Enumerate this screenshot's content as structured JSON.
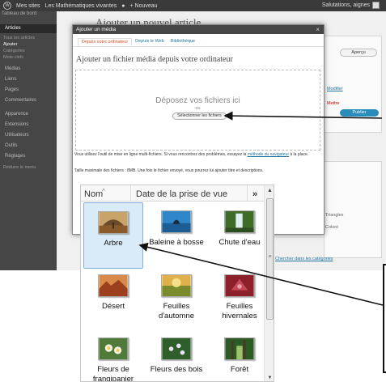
{
  "admin_bar": {
    "my_sites": "Mes sites",
    "site_name": "Les Mathématiques vivantes",
    "new_label": "+ Nouveau",
    "greeting": "Salutations, aignes"
  },
  "admin_menu": {
    "site_title": "Tableau de bord",
    "items": [
      "Articles",
      "Tous les articles",
      "Ajouter",
      "Catégories",
      "Mots-clefs",
      "Médias",
      "Liens",
      "Pages",
      "Commentaires",
      "Apparence",
      "Extensions",
      "Utilisateurs",
      "Outils",
      "Réglages",
      "Réduire le menu"
    ]
  },
  "editor": {
    "page_title": "Ajouter un nouvel article",
    "publish_button": "Publier",
    "save_button": "Aperçu",
    "side_link": "Modifier",
    "side_red": "Mettre",
    "side_links": [
      "Triangles",
      "Coloré"
    ],
    "bottom_link": "Chercher dans les catégories"
  },
  "modal": {
    "title": "Ajouter un média",
    "close": "×",
    "tabs": [
      "Depuis votre ordinateur",
      "Depuis le Web",
      "Bibliothèque"
    ],
    "upload_title": "Ajouter un fichier média depuis votre ordinateur",
    "drop_text": "Déposez vos fichiers ici",
    "or_text": "ou",
    "select_button": "Sélectionner les fichiers",
    "note_start": "Vous utilisez l'outil de mise en ligne multi-fichiers. Si vous rencontrez des problèmes, essayez la ",
    "note_link": "méthode du navigateur",
    "note_end": " à la place.",
    "max_size": "Taille maximale des fichiers : 8MB. Une fois le fichier envoyé, vous pourrez lui ajouter titre et descriptions."
  },
  "explorer": {
    "columns": [
      "Nom",
      "Date de la prise de vue",
      "»"
    ],
    "files": [
      {
        "name": "Arbre",
        "selected": true
      },
      {
        "name": "Baleine à bosse",
        "selected": false
      },
      {
        "name": "Chute d'eau",
        "selected": false
      },
      {
        "name": "Désert",
        "selected": false
      },
      {
        "name": "Feuilles d'automne",
        "selected": false
      },
      {
        "name": "Feuilles hivernales",
        "selected": false
      },
      {
        "name": "Fleurs de frangipanier",
        "selected": false
      },
      {
        "name": "Fleurs des bois",
        "selected": false
      },
      {
        "name": "Forêt",
        "selected": false
      }
    ]
  },
  "colors": {
    "admin_bar": "#3a3a3a",
    "admin_menu": "#464646",
    "link": "#21759b",
    "active_tab": "#d54e21",
    "selection": "#d9ebf9"
  }
}
